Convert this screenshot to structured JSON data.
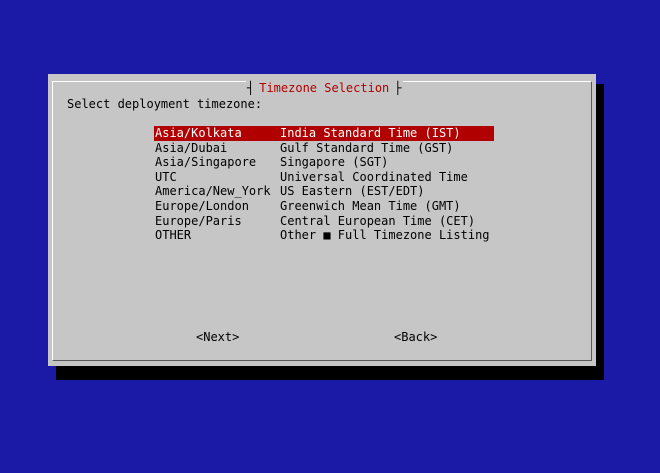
{
  "dialog": {
    "title": "Timezone Selection",
    "prompt": "Select deployment timezone:",
    "title_left_glyph": "┤",
    "title_right_glyph": "├"
  },
  "menu": {
    "selected_index": 0,
    "items": [
      {
        "tag": "Asia/Kolkata",
        "description": "India Standard Time (IST)"
      },
      {
        "tag": "Asia/Dubai",
        "description": "Gulf Standard Time (GST)"
      },
      {
        "tag": "Asia/Singapore",
        "description": "Singapore (SGT)"
      },
      {
        "tag": "UTC",
        "description": "Universal Coordinated Time"
      },
      {
        "tag": "America/New_York",
        "description": "US Eastern (EST/EDT)"
      },
      {
        "tag": "Europe/London",
        "description": "Greenwich Mean Time (GMT)"
      },
      {
        "tag": "Europe/Paris",
        "description": "Central European Time (CET)"
      },
      {
        "tag": "OTHER",
        "description": "Other ■ Full Timezone Listing"
      }
    ]
  },
  "buttons": {
    "next_label": "<Next>",
    "back_label": "<Back>"
  },
  "colors": {
    "background": "#1a1aa6",
    "dialog": "#c6c6c6",
    "accent": "#b00000",
    "selected_text": "#ffffff"
  }
}
